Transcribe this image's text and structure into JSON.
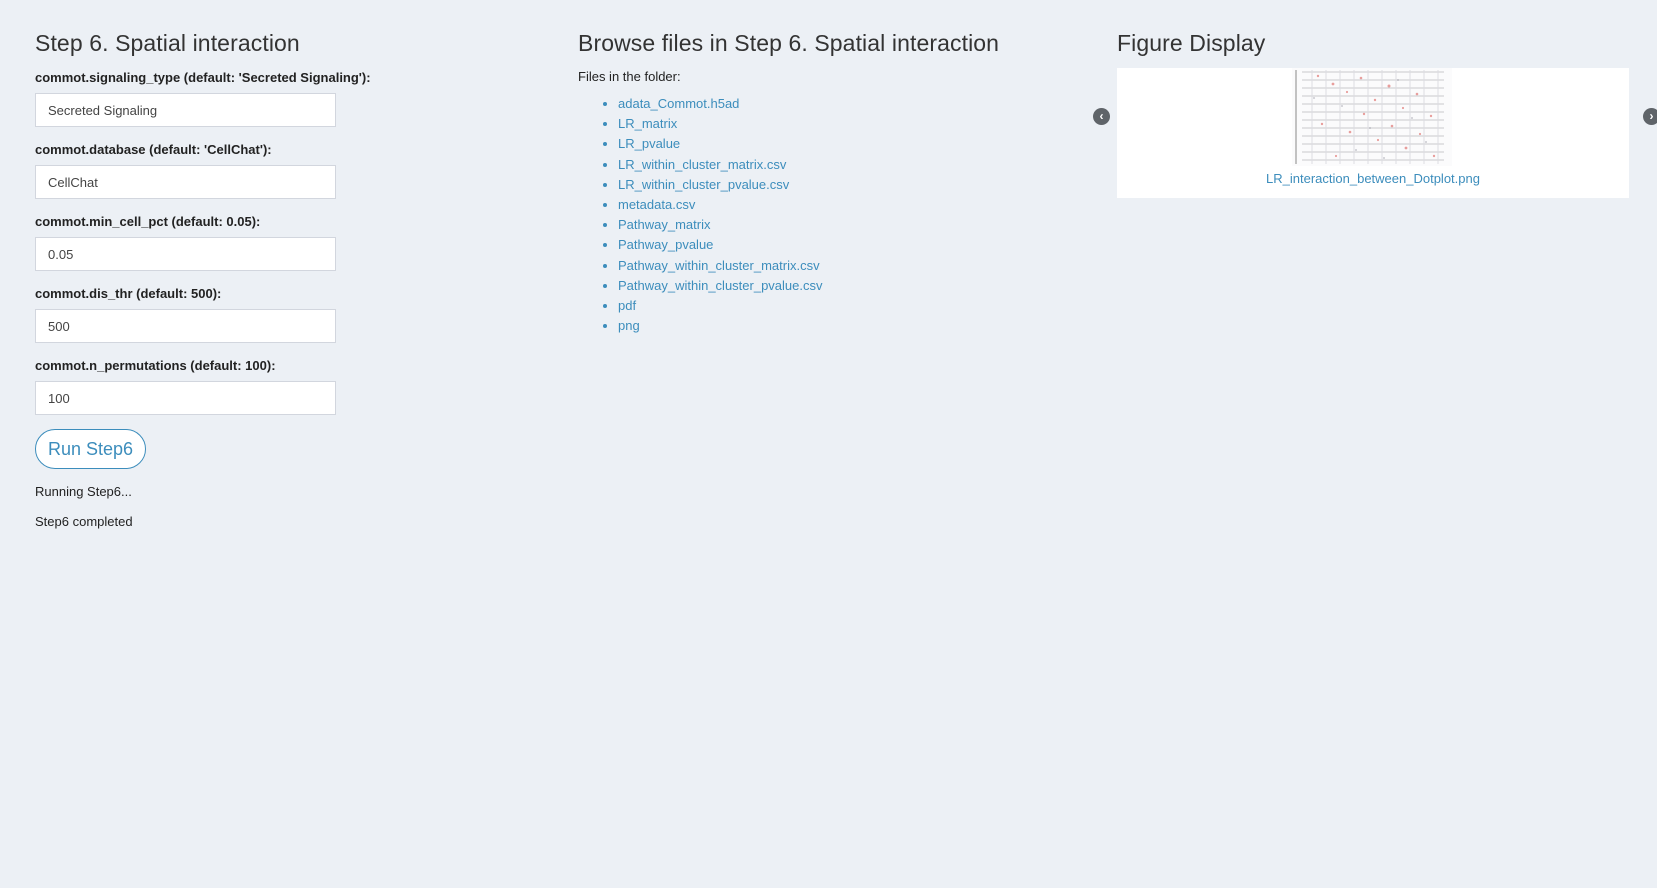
{
  "params_panel": {
    "title": "Step 6. Spatial interaction",
    "fields": [
      {
        "label": "commot.signaling_type (default: 'Secreted Signaling'):",
        "value": "Secreted Signaling"
      },
      {
        "label": "commot.database (default: 'CellChat'):",
        "value": "CellChat"
      },
      {
        "label": "commot.min_cell_pct (default: 0.05):",
        "value": "0.05"
      },
      {
        "label": "commot.dis_thr (default: 500):",
        "value": "500"
      },
      {
        "label": "commot.n_permutations (default: 100):",
        "value": "100"
      }
    ],
    "run_button": "Run Step6",
    "status_running": "Running Step6...",
    "status_completed": "Step6 completed"
  },
  "files_panel": {
    "title": "Browse files in Step 6. Spatial interaction",
    "folder_label": "Files in the folder:",
    "files": [
      "adata_Commot.h5ad",
      "LR_matrix",
      "LR_pvalue",
      "LR_within_cluster_matrix.csv",
      "LR_within_cluster_pvalue.csv",
      "metadata.csv",
      "Pathway_matrix",
      "Pathway_pvalue",
      "Pathway_within_cluster_matrix.csv",
      "Pathway_within_cluster_pvalue.csv",
      "pdf",
      "png"
    ]
  },
  "figure_panel": {
    "title": "Figure Display",
    "caption": "LR_interaction_between_Dotplot.png",
    "prev_icon": "chevron-left-circle",
    "next_icon": "chevron-right-circle"
  },
  "colors": {
    "background": "#ecf0f5",
    "link": "#3c8dbc",
    "arrow": "#5f6469"
  }
}
